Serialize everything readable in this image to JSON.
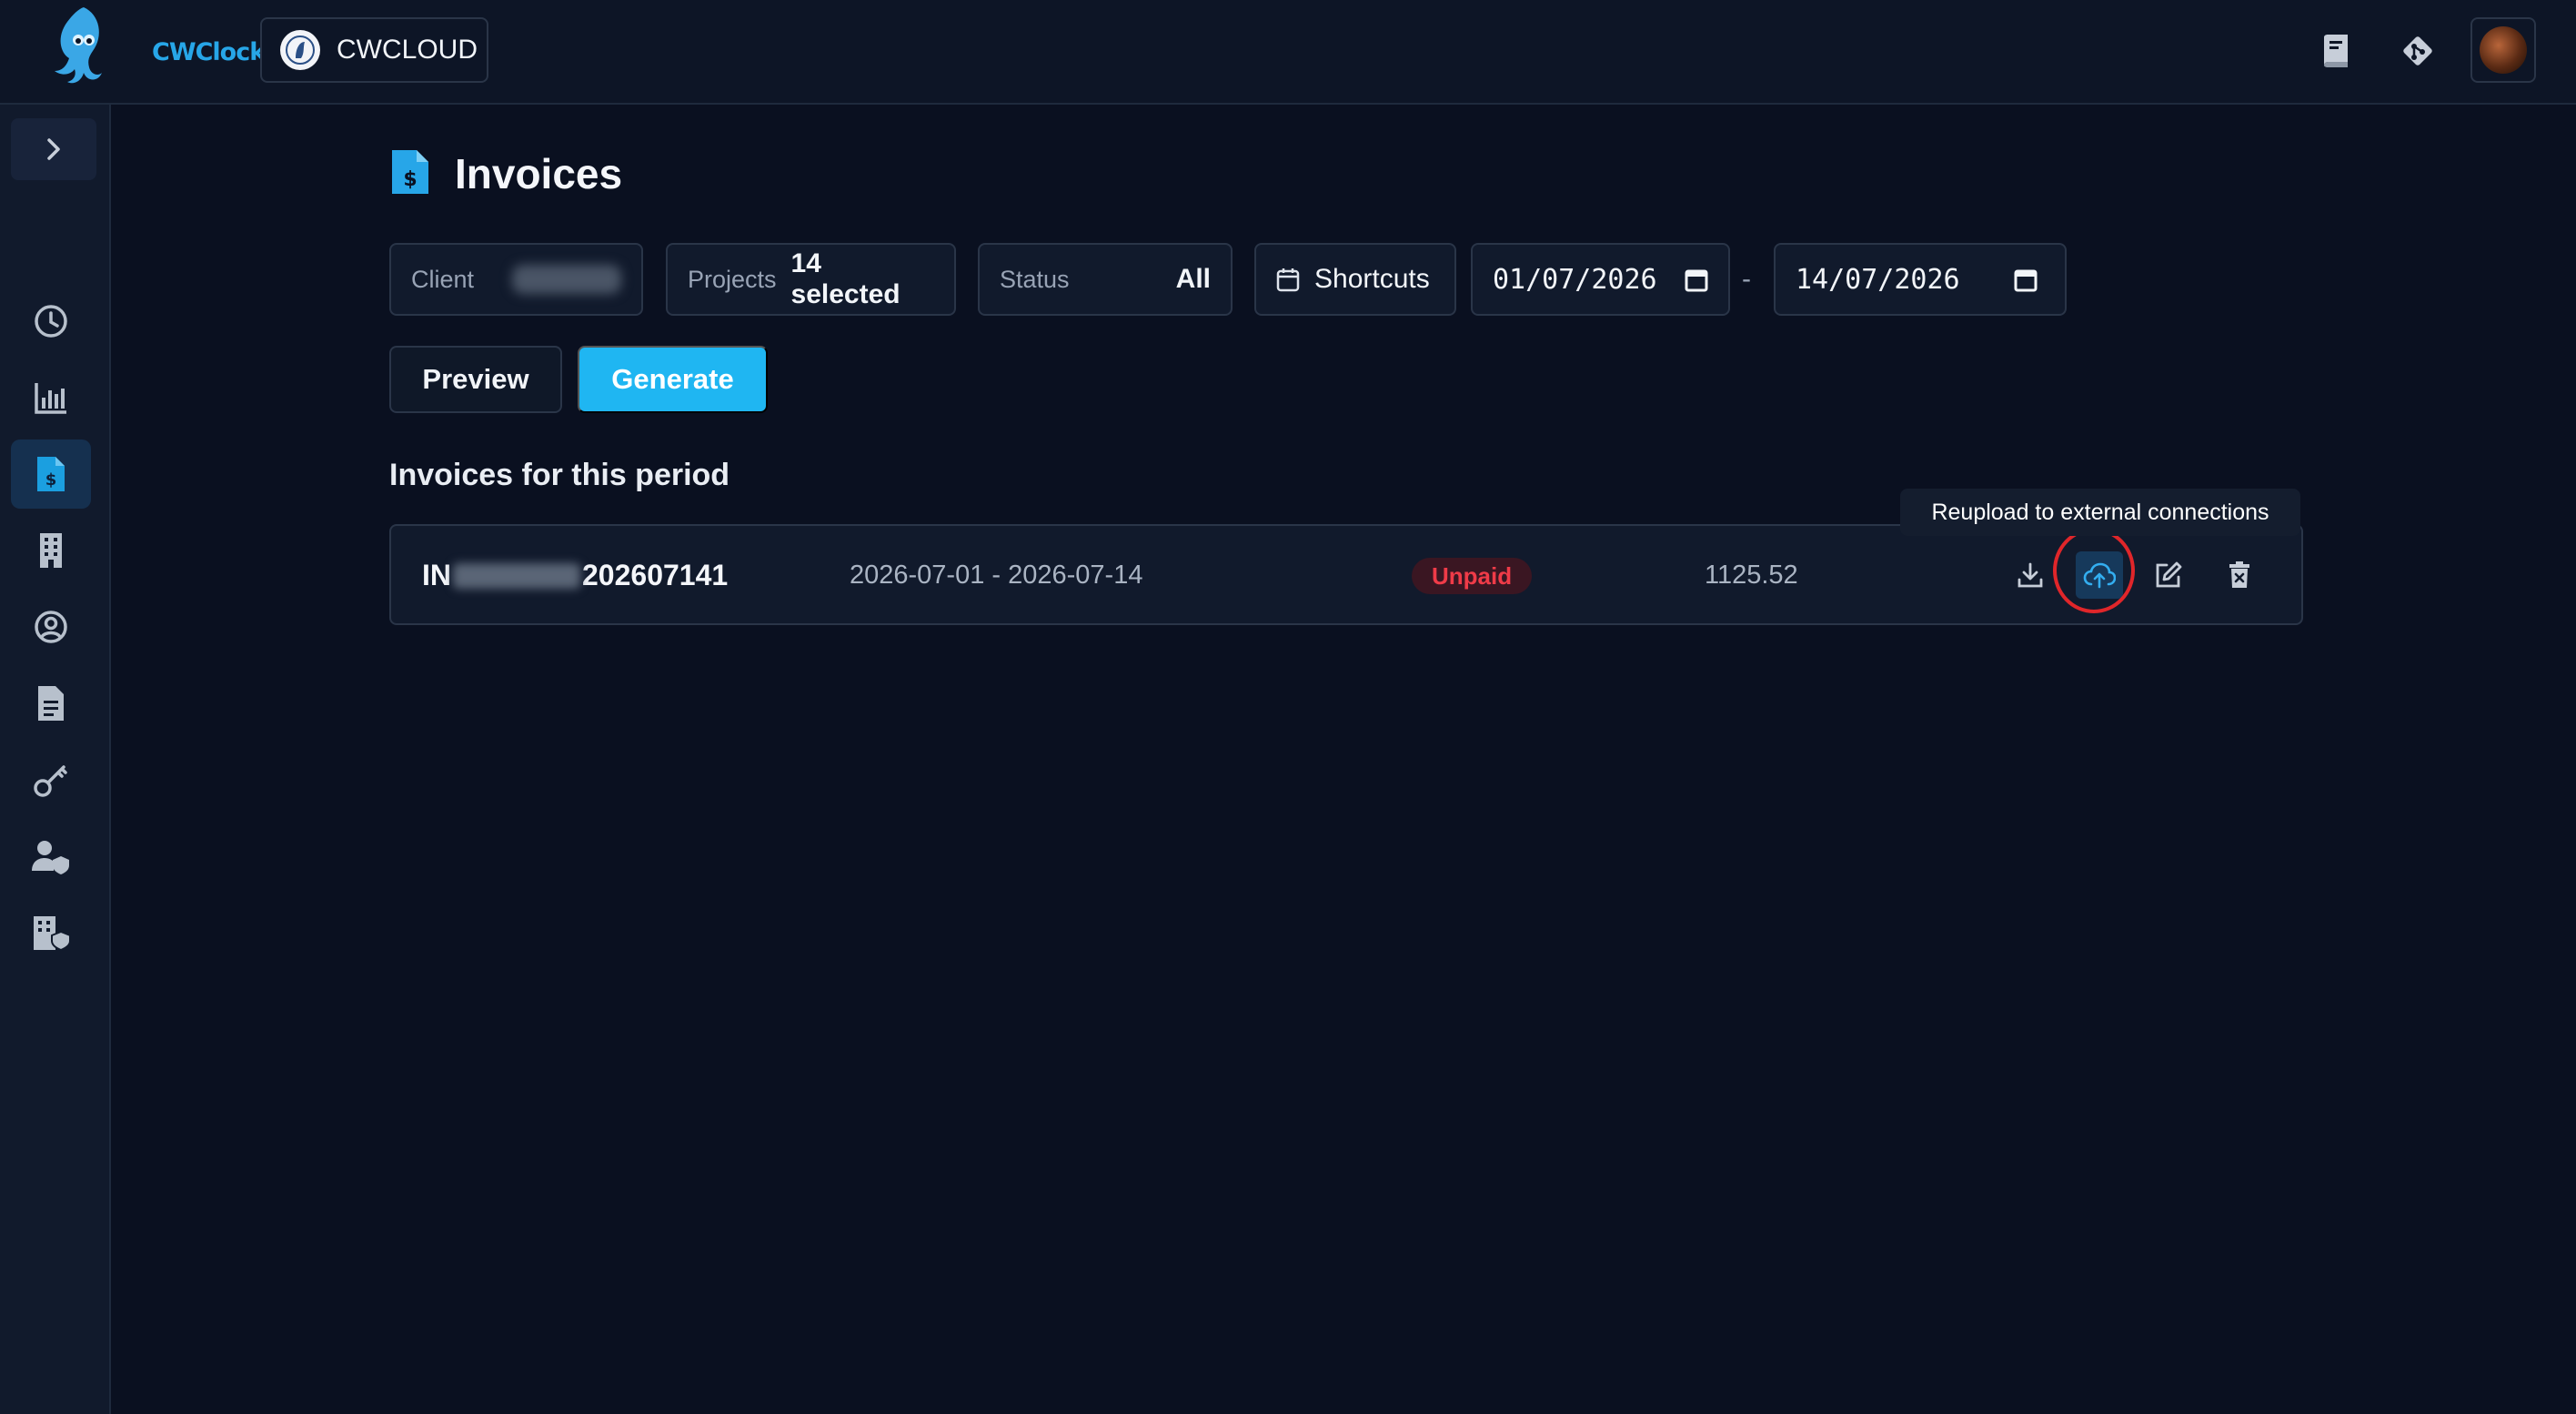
{
  "app": {
    "logo_text": "CWClock",
    "org_name": "CWCLOUD"
  },
  "header": {
    "icons": [
      "book-icon",
      "git-icon"
    ],
    "avatar": "user-avatar"
  },
  "sidebar": {
    "items": [
      {
        "icon": "clock-icon",
        "active": false
      },
      {
        "icon": "bar-chart-icon",
        "active": false
      },
      {
        "icon": "invoice-icon",
        "active": true
      },
      {
        "icon": "building-icon",
        "active": false
      },
      {
        "icon": "user-circle-icon",
        "active": false
      },
      {
        "icon": "document-icon",
        "active": false
      },
      {
        "icon": "key-icon",
        "active": false
      },
      {
        "icon": "user-shield-icon",
        "active": false
      },
      {
        "icon": "building-shield-icon",
        "active": false
      }
    ]
  },
  "page": {
    "title": "Invoices"
  },
  "filters": {
    "client_label": "Client",
    "projects_label": "Projects",
    "projects_value": "14 selected",
    "status_label": "Status",
    "status_value": "All",
    "shortcuts_label": "Shortcuts",
    "date_from": "01/07/2026",
    "date_separator": "-",
    "date_to": "14/07/2026"
  },
  "actions": {
    "preview_label": "Preview",
    "generate_label": "Generate"
  },
  "invoices": {
    "section_title": "Invoices for this period",
    "rows": [
      {
        "id_prefix": "IN",
        "id_suffix": "202607141",
        "period": "2026-07-01 - 2026-07-14",
        "status": "Unpaid",
        "amount": "1125.52"
      }
    ]
  },
  "tooltip": {
    "text": "Reupload to external connections"
  },
  "colors": {
    "accent": "#1fb6f2",
    "background": "#0a1020",
    "unpaid": "#ef3b48",
    "highlight_ring": "#e0262a"
  }
}
